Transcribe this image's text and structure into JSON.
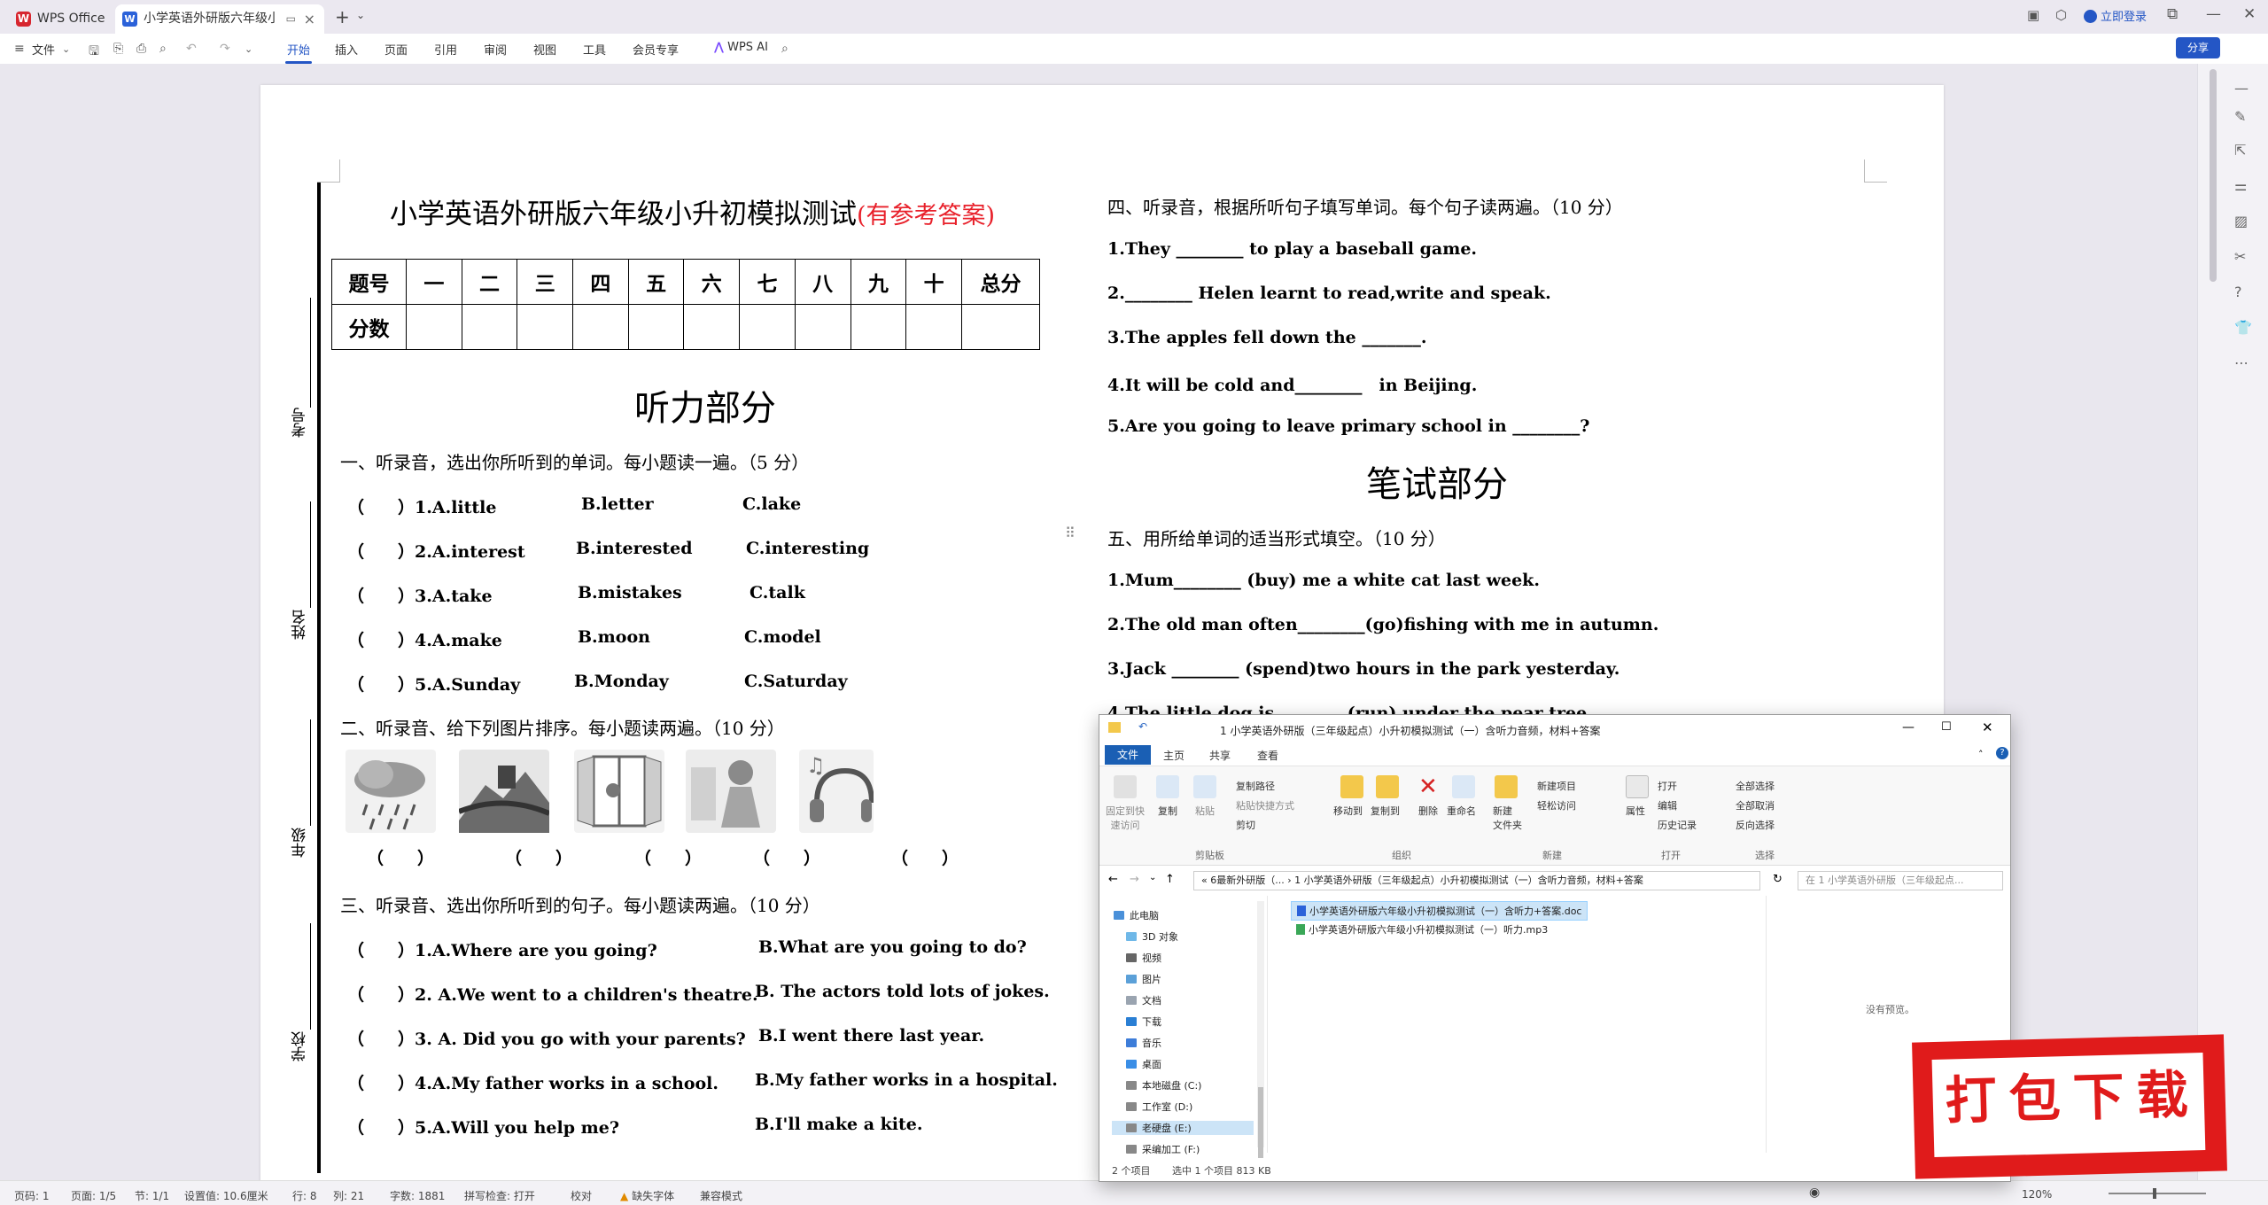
{
  "titlebar": {
    "wps_tab": "WPS Office",
    "doc_tab": "小学英语外研版六年级小升初模",
    "login": "立即登录"
  },
  "menu": {
    "file": "文件",
    "items": [
      "开始",
      "插入",
      "页面",
      "引用",
      "审阅",
      "视图",
      "工具",
      "会员专享"
    ],
    "wps_ai": "WPS AI",
    "share": "分享"
  },
  "doc": {
    "title_main": "小学英语外研版六年级小升初模拟测试",
    "title_red": "(有参考答案)",
    "binding_labels": [
      "考号",
      "姓名",
      "年级",
      "学校"
    ],
    "score_table": {
      "row1": [
        "题号",
        "一",
        "二",
        "三",
        "四",
        "五",
        "六",
        "七",
        "八",
        "九",
        "十",
        "总分"
      ],
      "row2": [
        "分数",
        "",
        "",
        "",
        "",
        "",
        "",
        "",
        "",
        "",
        "",
        ""
      ]
    },
    "listening_heading": "听力部分",
    "s1": "一、听录音，选出你所听到的单词。每小题读一遍。（5 分）",
    "s1_items": [
      [
        "（　　）1.A.little",
        "B.letter",
        "C.lake"
      ],
      [
        "（　　）2.A.interest",
        "B.interested",
        "C.interesting"
      ],
      [
        "（　　）3.A.take",
        "B.mistakes",
        "C.talk"
      ],
      [
        "（　　）4.A.make",
        "B.moon",
        "C.model"
      ],
      [
        "（　　）5.A.Sunday",
        "B.Monday",
        "C.Saturday"
      ]
    ],
    "s2": "二、听录音、给下列图片排序。每小题读两遍。（10 分）",
    "s2_brackets": [
      "（　　）",
      "（　　）",
      "（　　）",
      "（　　）",
      "（　　）"
    ],
    "s3": "三、听录音、选出你所听到的句子。每小题读两遍。（10 分）",
    "s3_items": [
      [
        "（　　）1.A.Where are you going?",
        "B.What are you going to do?"
      ],
      [
        "（　　）2. A.We went to a children's theatre.",
        "B. The actors told lots of jokes."
      ],
      [
        "（　　）3. A. Did you go with your parents?",
        "B.I went there last year."
      ],
      [
        "（　　）4.A.My father works in a school.",
        "B.My father works in a hospital."
      ],
      [
        "（　　）5.A.Will you help me?",
        "B.I'll make a kite."
      ]
    ],
    "s4": "四、听录音，根据所听句子填写单词。每个句子读两遍。（10 分）",
    "s4_items": [
      "1.They ________ to play a baseball game.",
      "2.________ Helen learnt to read,write and speak.",
      "3.The apples fell down the _______.",
      "4.It will be cold and________　in Beijing.",
      "5.Are you going to leave primary school in ________?"
    ],
    "written_heading": "笔试部分",
    "s5": "五、用所给单词的适当形式填空。（10 分）",
    "s5_items": [
      "1.Mum________ (buy) me a white cat last week.",
      "2.The old man often________(go)fishing with me in autumn.",
      "3.Jack ________ (spend)two hours in the park yesterday.",
      "4.The little dog is ________(run) under the pear tree."
    ]
  },
  "statusbar": {
    "items": [
      "页码: 1",
      "页面: 1/5",
      "节: 1/1",
      "设置值: 10.6厘米",
      "行: 8",
      "列: 21",
      "字数: 1881",
      "拼写检查: 打开",
      "校对",
      "缺失字体",
      "兼容模式"
    ],
    "zoom": "120%"
  },
  "explorer": {
    "title": "1 小学英语外研版（三年级起点）小升初模拟测试（一）含听力音频，材料+答案",
    "ribbon_tabs": [
      "文件",
      "主页",
      "共享",
      "查看"
    ],
    "ribbon": {
      "pin": "固定到快\n速访问",
      "copy": "复制",
      "paste": "粘贴",
      "copy_path": "复制路径",
      "paste_shortcut": "粘贴快捷方式",
      "cut": "剪切",
      "move_to": "移动到",
      "copy_to": "复制到",
      "delete": "删除",
      "rename": "重命名",
      "new_folder": "新建\n文件夹",
      "new_item": "新建项目",
      "easy_access": "轻松访问",
      "properties": "属性",
      "open": "打开",
      "edit": "编辑",
      "history": "历史记录",
      "select_all": "全部选择",
      "select_none": "全部取消",
      "invert": "反向选择",
      "groups": [
        "剪贴板",
        "组织",
        "新建",
        "打开",
        "选择"
      ]
    },
    "address": "«  6最新外研版（...  ›  1 小学英语外研版（三年级起点）小升初模拟测试（一）含听力音频，材料+答案",
    "search_placeholder": "在 1 小学英语外研版（三年级起点...",
    "nav": [
      "此电脑",
      "3D 对象",
      "视频",
      "图片",
      "文档",
      "下载",
      "音乐",
      "桌面",
      "本地磁盘 (C:)",
      "工作室 (D:)",
      "老硬盘 (E:)",
      "采编加工 (F:)"
    ],
    "files": [
      "小学英语外研版六年级小升初模拟测试（一）含听力+答案.doc",
      "小学英语外研版六年级小升初模拟测试（一）听力.mp3"
    ],
    "preview_text": "没有预览。",
    "status_count": "2 个项目",
    "status_selected": "选中 1 个项目  813 KB"
  },
  "promo": {
    "text": "打包下载"
  },
  "colors": {
    "accent": "#2456c5",
    "red_title": "#e8202a",
    "promo_red": "#e01b1b"
  }
}
